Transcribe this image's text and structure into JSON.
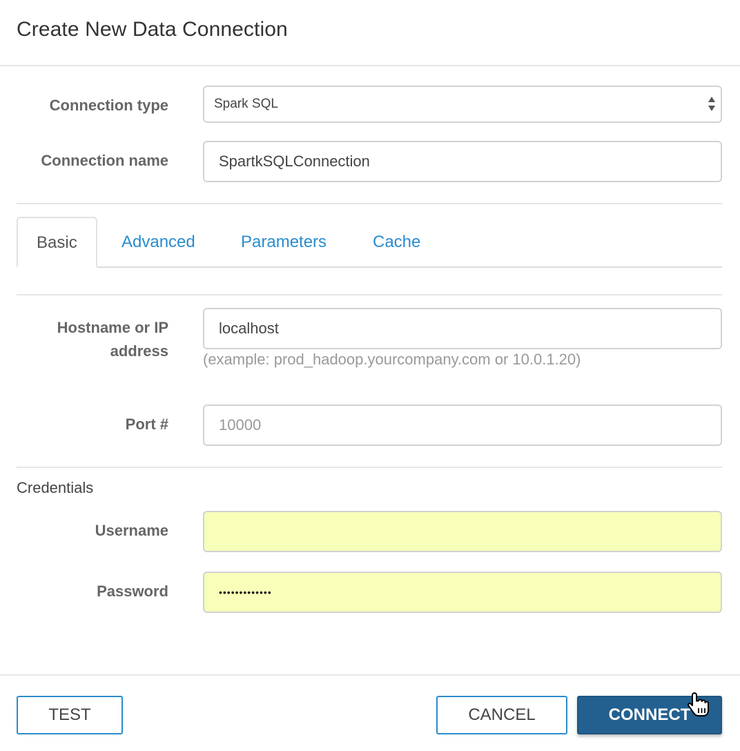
{
  "dialog": {
    "title": "Create New Data Connection"
  },
  "connection": {
    "type_label": "Connection type",
    "type_value": "Spark SQL",
    "name_label": "Connection name",
    "name_value": "SpartkSQLConnection"
  },
  "tabs": [
    {
      "label": "Basic",
      "active": true
    },
    {
      "label": "Advanced",
      "active": false
    },
    {
      "label": "Parameters",
      "active": false
    },
    {
      "label": "Cache",
      "active": false
    }
  ],
  "basic": {
    "hostname_label_line1": "Hostname or IP",
    "hostname_label_line2": "address",
    "hostname_value": "localhost",
    "hostname_hint": "(example: prod_hadoop.yourcompany.com or 10.0.1.20)",
    "port_label": "Port #",
    "port_placeholder": "10000"
  },
  "credentials": {
    "section_title": "Credentials",
    "username_label": "Username",
    "username_value": "",
    "password_label": "Password",
    "password_masked": "•••••••••••••"
  },
  "footer": {
    "test_label": "TEST",
    "cancel_label": "CANCEL",
    "connect_label": "CONNECT"
  },
  "colors": {
    "link_blue": "#2a8ccd",
    "primary_button": "#23608f",
    "autofill_yellow": "#f7ffb9"
  }
}
